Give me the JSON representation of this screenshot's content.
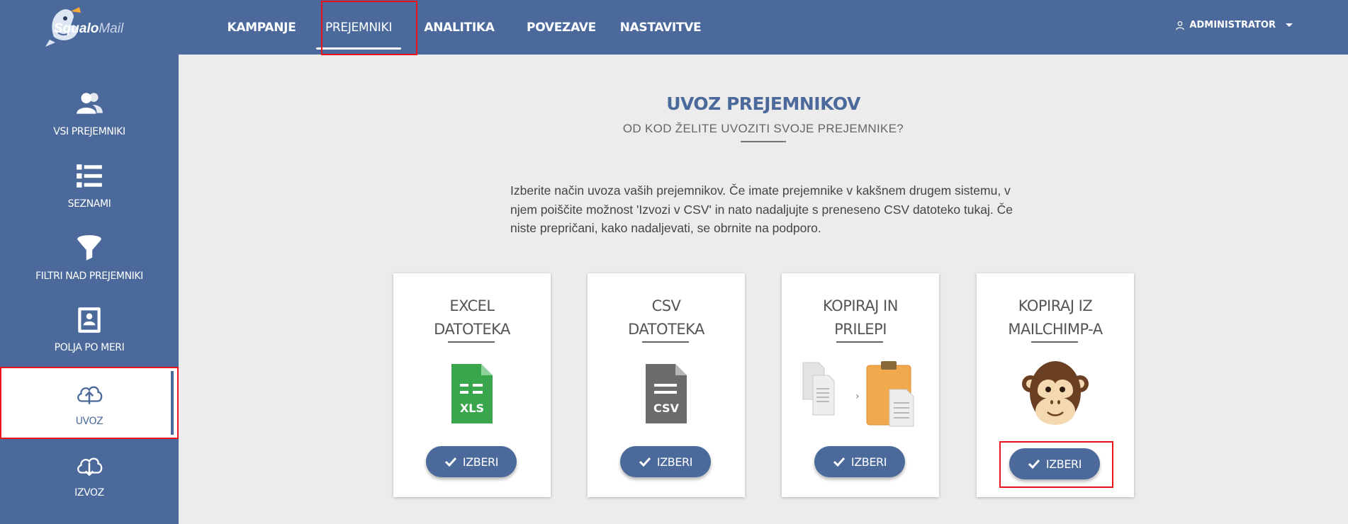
{
  "app": {
    "logo_main": "Squalo",
    "logo_light": "Mail"
  },
  "nav": {
    "items": [
      {
        "label": "KAMPANJE"
      },
      {
        "label": "PREJEMNIKI"
      },
      {
        "label": "ANALITIKA"
      },
      {
        "label": "POVEZAVE"
      },
      {
        "label": "NASTAVITVE"
      }
    ],
    "active": "PREJEMNIKI",
    "user": "ADMINISTRATOR"
  },
  "sidebar": {
    "items": [
      {
        "label": "VSI PREJEMNIKI",
        "icon": "users-icon"
      },
      {
        "label": "SEZNAMI",
        "icon": "list-icon"
      },
      {
        "label": "FILTRI NAD PREJEMNIKI",
        "icon": "funnel-icon"
      },
      {
        "label": "POLJA PO MERI",
        "icon": "id-card-icon"
      },
      {
        "label": "UVOZ",
        "icon": "cloud-upload-icon"
      },
      {
        "label": "IZVOZ",
        "icon": "cloud-download-icon"
      }
    ],
    "active": "UVOZ"
  },
  "main": {
    "title": "UVOZ PREJEMNIKOV",
    "subtitle": "OD KOD ŽELITE UVOZITI SVOJE PREJEMNIKE?",
    "intro": "Izberite način uvoza vaših prejemnikov. Če imate prejemnike v kakšnem drugem sistemu, v njem poiščite možnost 'Izvozi v CSV' in nato nadaljujte s preneseno CSV datoteko tukaj. Če niste prepričani, kako nadaljevati, se obrnite na podporo.",
    "cards": [
      {
        "title_line1": "EXCEL",
        "title_line2": "DATOTEKA",
        "icon": "xls-file-icon",
        "file_label": "XLS",
        "button": "IZBERI"
      },
      {
        "title_line1": "CSV",
        "title_line2": "DATOTEKA",
        "icon": "csv-file-icon",
        "file_label": "CSV",
        "button": "IZBERI"
      },
      {
        "title_line1": "KOPIRAJ IN",
        "title_line2": "PRILEPI",
        "icon": "copy-paste-icon",
        "button": "IZBERI"
      },
      {
        "title_line1": "KOPIRAJ IZ",
        "title_line2": "MAILCHIMP-A",
        "icon": "mailchimp-monkey-icon",
        "button": "IZBERI"
      }
    ]
  },
  "colors": {
    "brand": "#4b6a9b",
    "highlight": "#e8131b",
    "excel_green": "#3aa64b",
    "csv_gray": "#6b6b6b"
  }
}
